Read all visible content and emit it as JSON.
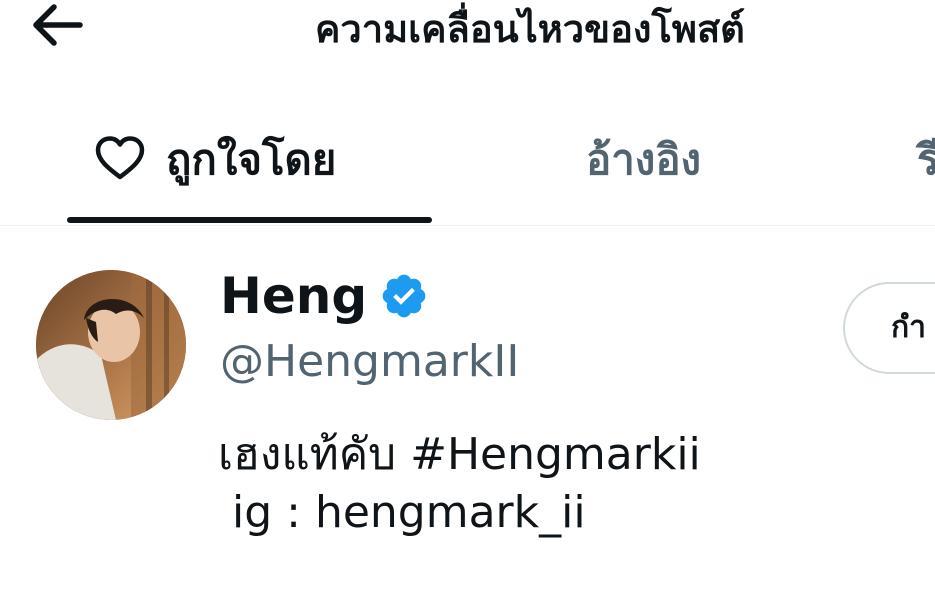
{
  "header": {
    "title": "ความเคลื่อนไหวของโพสต์",
    "back_icon": "arrow-left-icon"
  },
  "tabs": [
    {
      "label": "ถูกใจโดย",
      "icon": "heart-icon",
      "selected": true
    },
    {
      "label": "อ้างอิง",
      "selected": false
    },
    {
      "label": "รี",
      "selected": false
    }
  ],
  "user": {
    "display_name": "Heng",
    "verified": true,
    "handle": "@HengmarkII",
    "bio": "เฮงแท้คับ #Hengmarkii\n ig : hengmark_ii",
    "follow_button_label": "กำ"
  },
  "colors": {
    "text_primary": "#0f1419",
    "text_secondary": "#536471",
    "verified_blue": "#1d9bf0",
    "border": "#cfd9de",
    "divider": "#eff3f4"
  }
}
